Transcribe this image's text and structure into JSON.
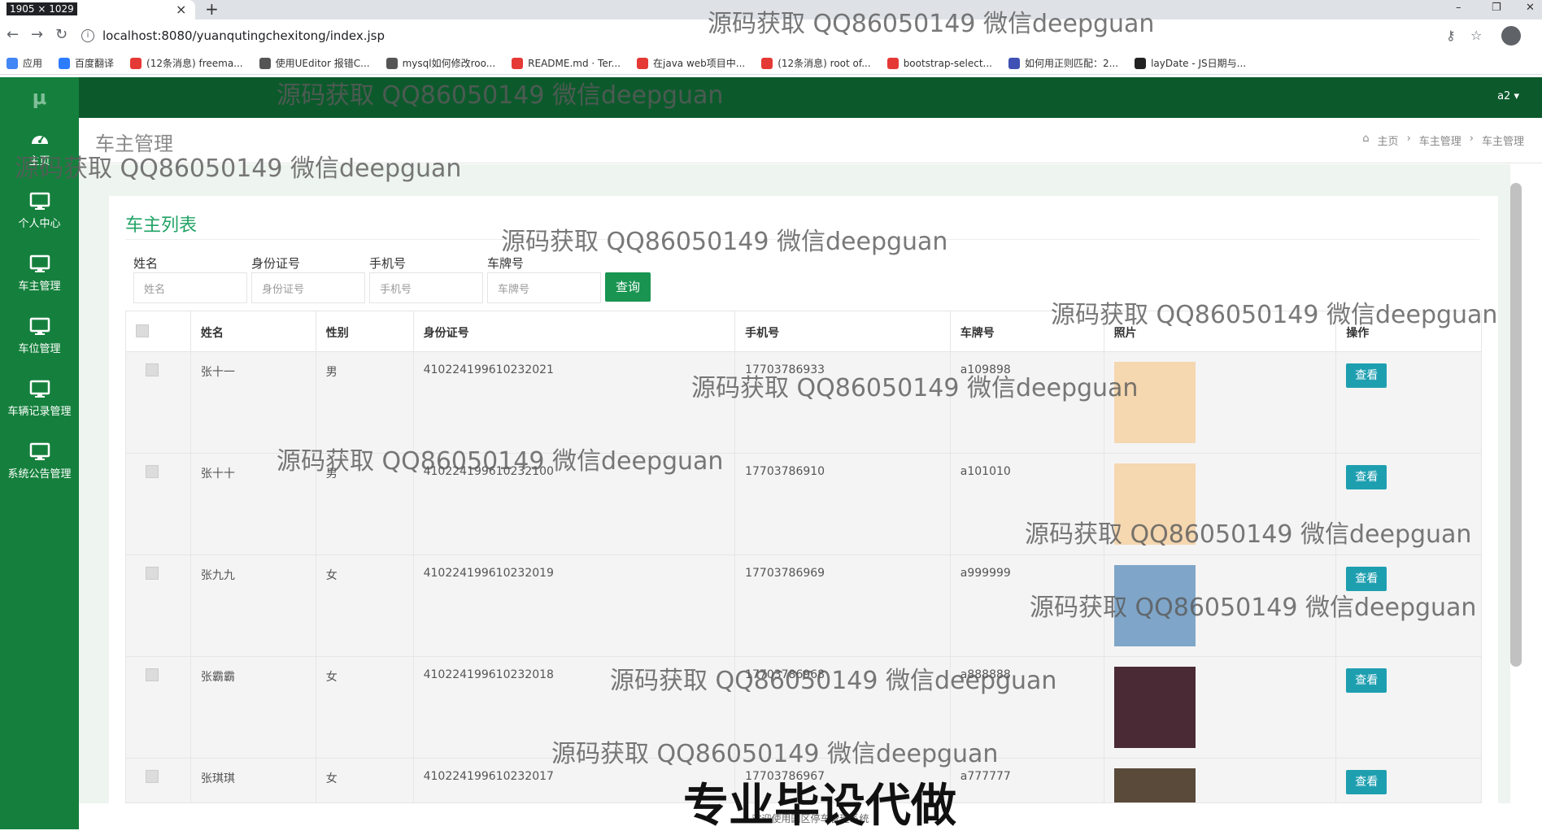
{
  "browser": {
    "dim_label": "1905 × 1029",
    "tab_close": "×",
    "new_tab": "+",
    "url": "localhost:8080/yuanqutingchexitong/index.jsp",
    "bookmarks": [
      {
        "label": "应用",
        "color": "#4285f4"
      },
      {
        "label": "百度翻译",
        "color": "#2b7cff"
      },
      {
        "label": "(12条消息) freema...",
        "color": "#e53935"
      },
      {
        "label": "使用UEditor 报错C...",
        "color": "#555"
      },
      {
        "label": "mysql如何修改roo...",
        "color": "#555"
      },
      {
        "label": "README.md · Ter...",
        "color": "#e53935"
      },
      {
        "label": "在java web项目中...",
        "color": "#e53935"
      },
      {
        "label": "(12条消息) root of...",
        "color": "#e53935"
      },
      {
        "label": "bootstrap-select...",
        "color": "#e53935"
      },
      {
        "label": "如何用正则匹配：2...",
        "color": "#3f51b5"
      },
      {
        "label": "layDate - JS日期与...",
        "color": "#222"
      }
    ]
  },
  "sidebar": {
    "logo": "μ",
    "items": [
      {
        "label": "主页",
        "icon": "dashboard-icon"
      },
      {
        "label": "个人中心",
        "icon": "monitor-icon"
      },
      {
        "label": "车主管理",
        "icon": "monitor-icon"
      },
      {
        "label": "车位管理",
        "icon": "monitor-icon"
      },
      {
        "label": "车辆记录管理",
        "icon": "monitor-icon"
      },
      {
        "label": "系统公告管理",
        "icon": "monitor-icon"
      }
    ]
  },
  "topbar": {
    "user": "a2 ▾"
  },
  "header": {
    "title": "车主管理",
    "breadcrumb": [
      "主页",
      "车主管理",
      "车主管理"
    ]
  },
  "card": {
    "title": "车主列表",
    "filters": [
      {
        "label": "姓名",
        "placeholder": "姓名"
      },
      {
        "label": "身份证号",
        "placeholder": "身份证号"
      },
      {
        "label": "手机号",
        "placeholder": "手机号"
      },
      {
        "label": "车牌号",
        "placeholder": "车牌号"
      }
    ],
    "search_label": "查询"
  },
  "table": {
    "headers": [
      "姓名",
      "性别",
      "身份证号",
      "手机号",
      "车牌号",
      "照片",
      "操作"
    ],
    "view_label": "查看",
    "rows": [
      {
        "name": "张十一",
        "gender": "男",
        "id": "410224199610232021",
        "phone": "17703786933",
        "plate": "a109898",
        "photo": "#f5d7b0"
      },
      {
        "name": "张十十",
        "gender": "男",
        "id": "410224199610232100",
        "phone": "17703786910",
        "plate": "a101010",
        "photo": "#f5d7b0"
      },
      {
        "name": "张九九",
        "gender": "女",
        "id": "410224199610232019",
        "phone": "17703786969",
        "plate": "a999999",
        "photo": "#7fa6c9"
      },
      {
        "name": "张霸霸",
        "gender": "女",
        "id": "410224199610232018",
        "phone": "17703786968",
        "plate": "a888888",
        "photo": "#4a2a35"
      },
      {
        "name": "张琪琪",
        "gender": "女",
        "id": "410224199610232017",
        "phone": "17703786967",
        "plate": "a777777",
        "photo": "#5a4a3a"
      }
    ]
  },
  "footer": {
    "text": "欢迎使用园区停车管理系统"
  },
  "watermarks": {
    "text": "源码获取 QQ86050149 微信deepguan",
    "big": "专业毕设代做"
  }
}
